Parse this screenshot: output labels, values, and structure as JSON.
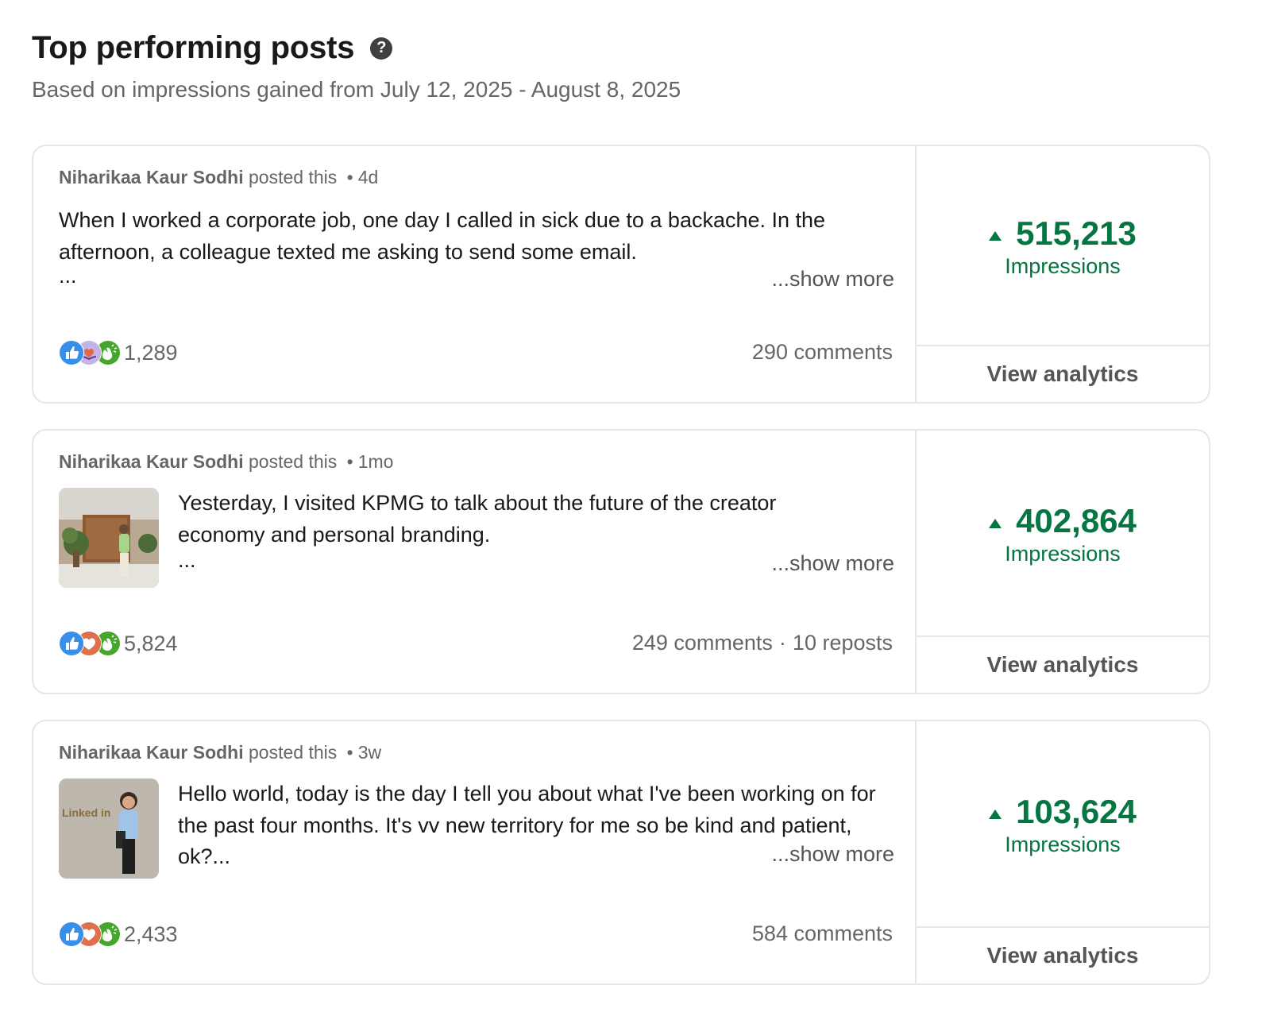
{
  "header": {
    "title": "Top performing posts",
    "help_icon": "question-circle-icon",
    "subtitle": "Based on impressions gained from July 12, 2025 - August 8, 2025"
  },
  "posts": [
    {
      "author": "Niharikaa Kaur Sodhi",
      "action": "posted this",
      "separator": "•",
      "age": "4d",
      "text": "When I worked a corporate job, one day I called in sick due to a backache. In the afternoon, a colleague texted me asking to send some email.",
      "ellipsis": "...",
      "show_more": "...show more",
      "reaction_icons": [
        "like-icon",
        "support-icon",
        "celebrate-icon"
      ],
      "reactions": "1,289",
      "comments": "290 comments",
      "reposts": "",
      "impressions": "515,213",
      "impressions_label": "Impressions",
      "view_analytics": "View analytics"
    },
    {
      "author": "Niharikaa Kaur Sodhi",
      "action": "posted this",
      "separator": "•",
      "age": "1mo",
      "text": "Yesterday, I visited KPMG to talk about the future of the creator economy and personal branding.",
      "ellipsis": "...",
      "show_more": "...show more",
      "reaction_icons": [
        "like-icon",
        "love-icon",
        "celebrate-icon"
      ],
      "reactions": "5,824",
      "comments": "249 comments",
      "stats_separator": "·",
      "reposts": "10 reposts",
      "impressions": "402,864",
      "impressions_label": "Impressions",
      "view_analytics": "View analytics"
    },
    {
      "author": "Niharikaa Kaur Sodhi",
      "action": "posted this",
      "separator": "•",
      "age": "3w",
      "text": "Hello world, today is the day I tell you about what I've been working on for the past four months. It's vv new territory for me so be kind and patient, ok?...",
      "show_more": "...show more",
      "reaction_icons": [
        "like-icon",
        "love-icon",
        "celebrate-icon"
      ],
      "reactions": "2,433",
      "comments": "584 comments",
      "reposts": "",
      "impressions": "103,624",
      "impressions_label": "Impressions",
      "view_analytics": "View analytics",
      "thumb_sign": "Linked in"
    }
  ],
  "colors": {
    "accent_green": "#057642",
    "border": "#e6e6e6",
    "muted_text": "#666666"
  }
}
